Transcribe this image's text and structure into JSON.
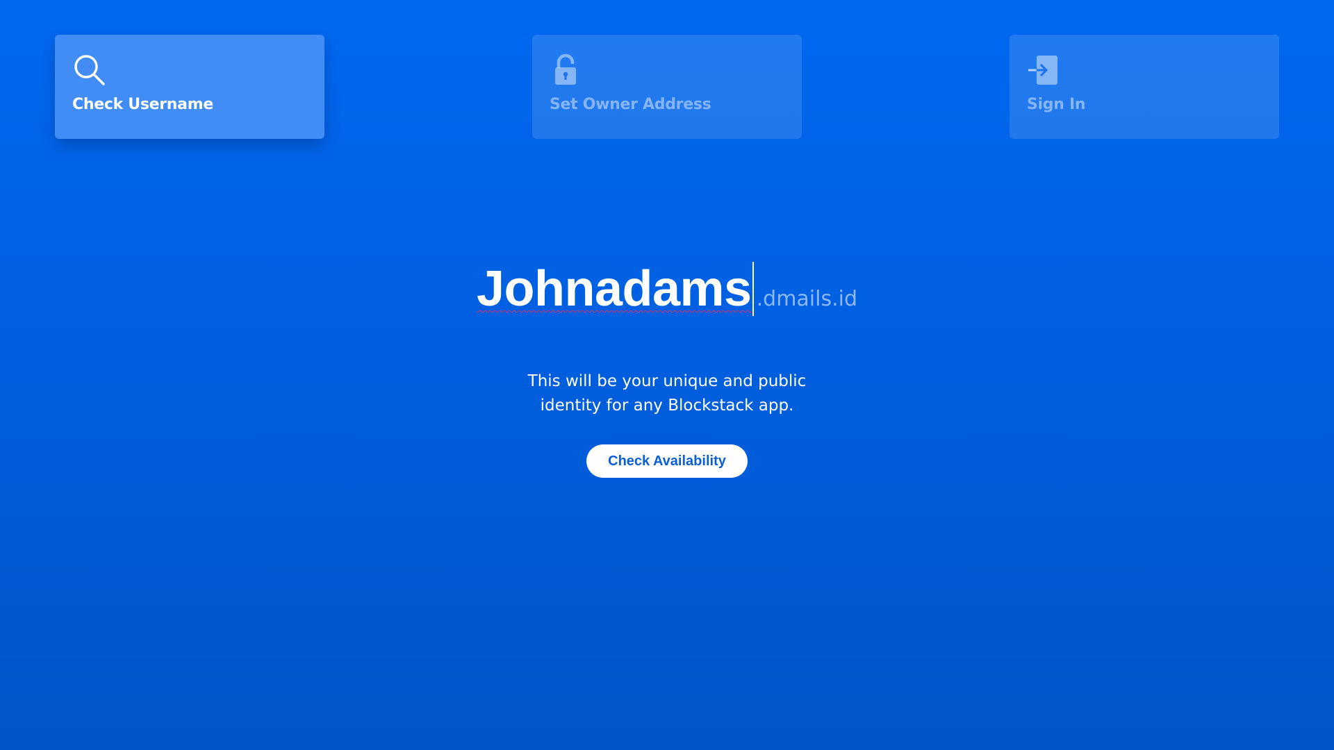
{
  "steps": [
    {
      "label": "Check Username",
      "icon": "search-icon",
      "active": true
    },
    {
      "label": "Set Owner Address",
      "icon": "lock-icon",
      "active": false
    },
    {
      "label": "Sign In",
      "icon": "sign-in-icon",
      "active": false
    }
  ],
  "username": {
    "value": "Johnadams",
    "suffix": ".dmails.id"
  },
  "description": {
    "line1": "This will be your unique and public",
    "line2": "identity for any Blockstack app."
  },
  "check_button": {
    "label": "Check Availability"
  },
  "colors": {
    "background": "#0064ea",
    "active_step": "#418cf5",
    "button_text": "#0b5fd6",
    "spell_underline": "#e0306a"
  }
}
